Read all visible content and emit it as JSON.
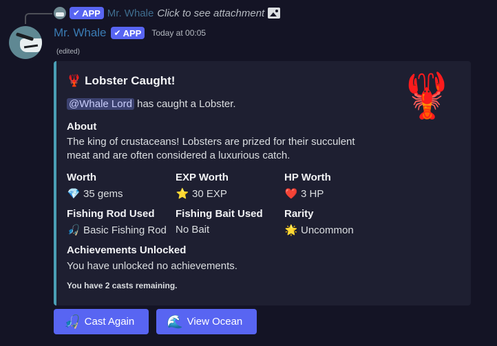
{
  "reply": {
    "badge": "APP",
    "name": "Mr. Whale",
    "text": "Click to see attachment",
    "attachment_icon": "image-icon"
  },
  "message": {
    "author": "Mr. Whale",
    "badge": "APP",
    "timestamp": "Today at 00:05",
    "edited": "(edited)"
  },
  "embed": {
    "accent_color": "#4a9fb5",
    "title_emoji": "🦞",
    "title": "Lobster Caught!",
    "mention": "@Whale Lord",
    "description": "has caught a Lobster.",
    "thumbnail_emoji": "🦞",
    "about_label": "About",
    "about_text": "The king of crustaceans! Lobsters are prized for their succulent meat and are often considered a luxurious catch.",
    "fields": {
      "worth": {
        "name": "Worth",
        "emoji": "💎",
        "value": "35 gems"
      },
      "exp": {
        "name": "EXP Worth",
        "emoji": "⭐",
        "value": "30 EXP"
      },
      "hp": {
        "name": "HP Worth",
        "emoji": "❤️",
        "value": "3 HP"
      },
      "rod": {
        "name": "Fishing Rod Used",
        "emoji": "🎣",
        "value": "Basic Fishing Rod"
      },
      "bait": {
        "name": "Fishing Bait Used",
        "value": "No Bait"
      },
      "rarity": {
        "name": "Rarity",
        "emoji": "🌟",
        "value": "Uncommon"
      },
      "achievements": {
        "name": "Achievements Unlocked",
        "value": "You have unlocked no achievements."
      }
    },
    "footer": "You have 2 casts remaining."
  },
  "buttons": [
    {
      "emoji": "🎣",
      "label": "Cast Again"
    },
    {
      "emoji": "🌊",
      "label": "View Ocean"
    }
  ],
  "colors": {
    "brand": "#5865f2",
    "background": "#141425",
    "embed_bg": "#1e1f31"
  }
}
